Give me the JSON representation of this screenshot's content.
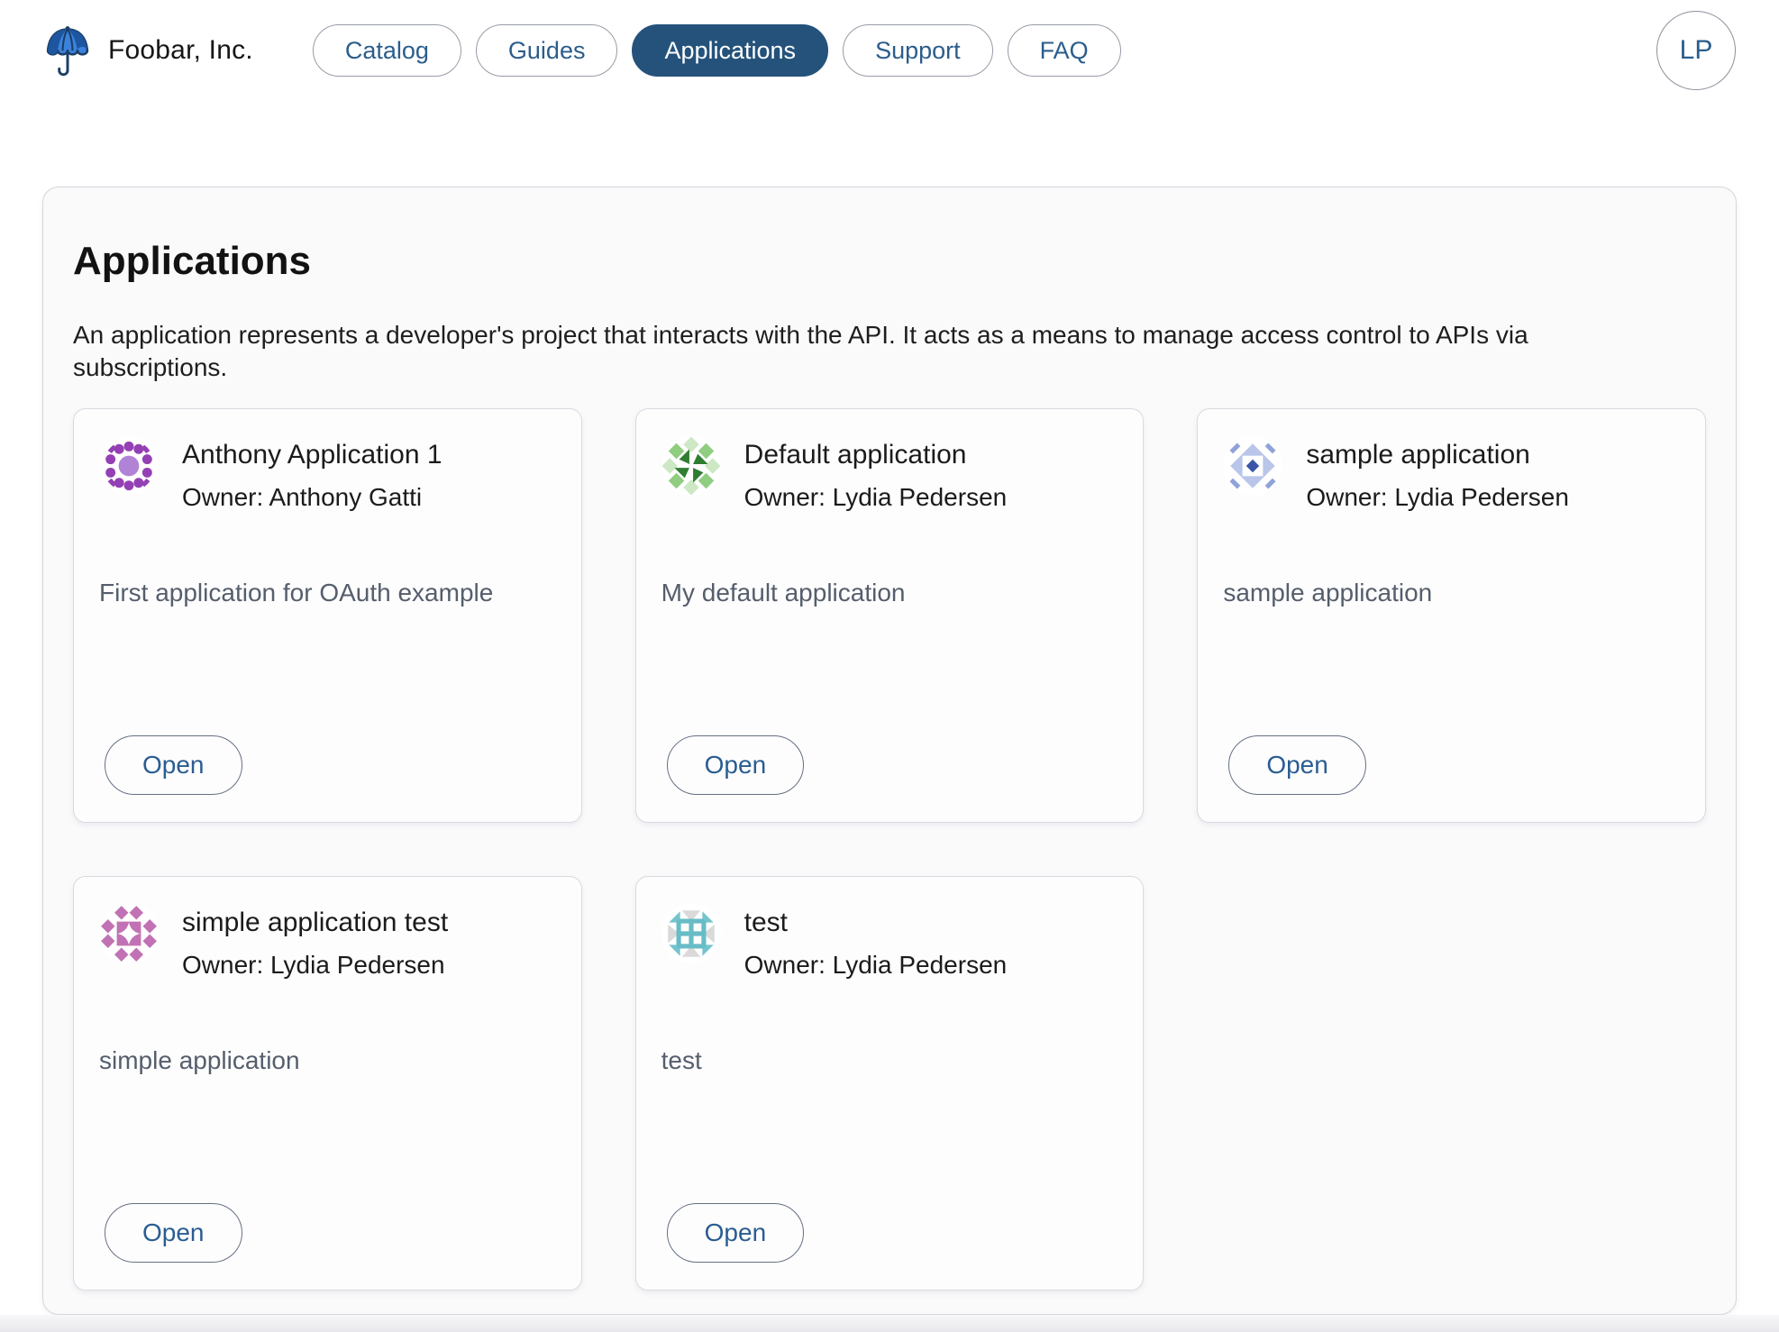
{
  "header": {
    "brand": "Foobar, Inc.",
    "logo_icon": "umbrella-icon",
    "nav": [
      {
        "label": "Catalog",
        "active": false
      },
      {
        "label": "Guides",
        "active": false
      },
      {
        "label": "Applications",
        "active": true
      },
      {
        "label": "Support",
        "active": false
      },
      {
        "label": "FAQ",
        "active": false
      }
    ],
    "avatar_initials": "LP"
  },
  "main": {
    "title": "Applications",
    "description": "An application represents a developer's project that interacts with the API. It acts as a means to manage access control to APIs via subscriptions.",
    "open_label": "Open",
    "cards": [
      {
        "title": "Anthony Application 1",
        "owner": "Owner: Anthony Gatti",
        "description": "First application for OAuth example",
        "icon": "purple-dots-identicon"
      },
      {
        "title": "Default application",
        "owner": "Owner: Lydia Pedersen",
        "description": "My default application",
        "icon": "green-pinwheel-identicon"
      },
      {
        "title": "sample application",
        "owner": "Owner: Lydia Pedersen",
        "description": "sample application",
        "icon": "blue-diamond-identicon"
      },
      {
        "title": "simple application test",
        "owner": "Owner: Lydia Pedersen",
        "description": "simple application",
        "icon": "pink-star-identicon"
      },
      {
        "title": "test",
        "owner": "Owner: Lydia Pedersen",
        "description": "test",
        "icon": "teal-grid-identicon"
      }
    ]
  },
  "colors": {
    "accent_navy": "#24527b",
    "link_blue": "#2b5d8c",
    "panel_bg": "#fafafb",
    "card_border": "#d9d9e0",
    "desc_gray": "#555e6c",
    "identicon_purple": "#9440b4",
    "identicon_green": "#2f7d33",
    "identicon_blue": "#3a55a8",
    "identicon_pink": "#c172b4",
    "identicon_teal": "#72c0c9"
  }
}
